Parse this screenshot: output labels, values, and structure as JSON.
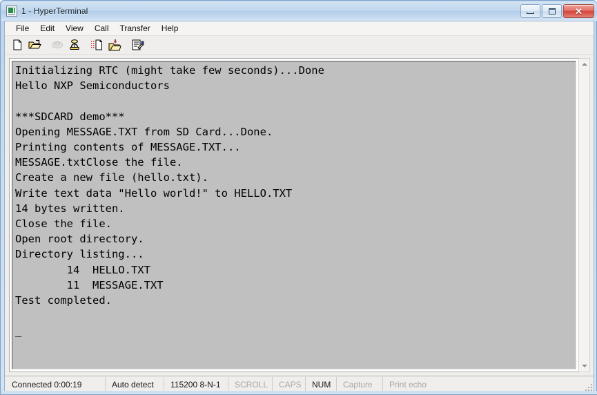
{
  "window": {
    "title": "1 - HyperTerminal",
    "app_icon": "terminal-monitor-icon",
    "buttons": {
      "minimize": "–",
      "maximize": "□",
      "close": "✕"
    }
  },
  "menubar": {
    "items": [
      {
        "label": "File"
      },
      {
        "label": "Edit"
      },
      {
        "label": "View"
      },
      {
        "label": "Call"
      },
      {
        "label": "Transfer"
      },
      {
        "label": "Help"
      }
    ]
  },
  "toolbar": {
    "buttons": [
      {
        "name": "new-connection-icon",
        "title": "New",
        "enabled": true
      },
      {
        "name": "open-folder-icon",
        "title": "Open",
        "enabled": true
      },
      {
        "name": "disconnect-phone-icon",
        "title": "Disconnect",
        "enabled": false
      },
      {
        "name": "call-phone-icon",
        "title": "Call",
        "enabled": true
      },
      {
        "name": "send-file-icon",
        "title": "Send",
        "enabled": true
      },
      {
        "name": "receive-file-icon",
        "title": "Receive",
        "enabled": true
      },
      {
        "name": "properties-icon",
        "title": "Properties",
        "enabled": true
      }
    ]
  },
  "terminal": {
    "background_color": "#c0c0c0",
    "text_color": "#000000",
    "cursor": "_",
    "lines": [
      "Initializing RTC (might take few seconds)...Done",
      "Hello NXP Semiconductors",
      "",
      "***SDCARD demo***",
      "Opening MESSAGE.TXT from SD Card...Done.",
      "Printing contents of MESSAGE.TXT...",
      "MESSAGE.txtClose the file.",
      "Create a new file (hello.txt).",
      "Write text data \"Hello world!\" to HELLO.TXT",
      "14 bytes written.",
      "Close the file.",
      "Open root directory.",
      "Directory listing...",
      "        14  HELLO.TXT",
      "        11  MESSAGE.TXT",
      "Test completed.",
      "",
      "_"
    ]
  },
  "scrollbar": {
    "up_arrow": "scroll-up-arrow",
    "down_arrow": "scroll-down-arrow"
  },
  "statusbar": {
    "connection": "Connected 0:00:19",
    "detect": "Auto detect",
    "settings": "115200 8-N-1",
    "scroll": "SCROLL",
    "caps": "CAPS",
    "num": "NUM",
    "capture": "Capture",
    "print_echo": "Print echo"
  }
}
